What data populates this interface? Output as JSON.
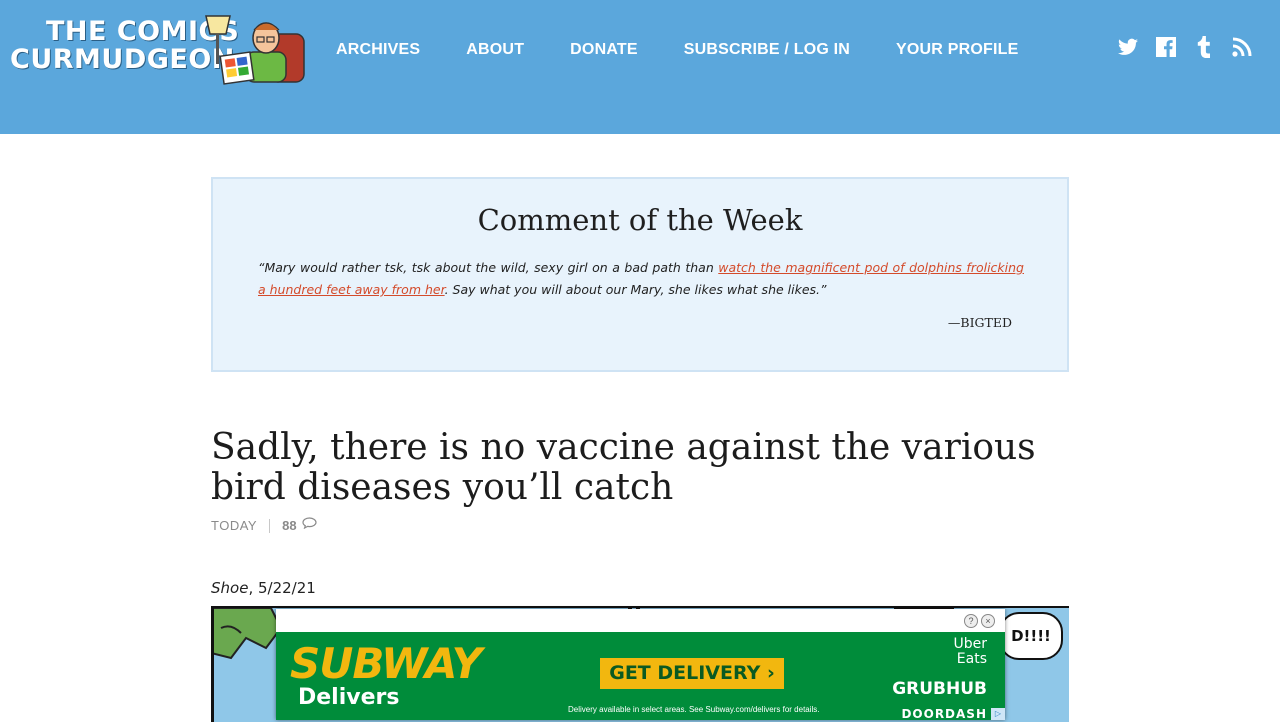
{
  "site": {
    "logo_line1": "THE COMICS",
    "logo_line2": "CURMUDGEON"
  },
  "nav": {
    "items": [
      {
        "label": "ARCHIVES"
      },
      {
        "label": "ABOUT"
      },
      {
        "label": "DONATE"
      },
      {
        "label": "SUBSCRIBE / LOG IN"
      },
      {
        "label": "YOUR PROFILE"
      }
    ]
  },
  "social": {
    "icons": [
      "twitter-icon",
      "facebook-icon",
      "tumblr-icon",
      "rss-icon"
    ]
  },
  "comment_of_week": {
    "title": "Comment of the Week",
    "quote_before": "“Mary would rather tsk, tsk about the wild, sexy girl on a bad path than ",
    "quote_link": "watch the magnificent pod of dolphins frolicking a hundred feet away from her",
    "quote_after": ". Say what you will about our Mary, she likes what she likes.”",
    "author": "—BIGTED"
  },
  "post": {
    "title": "Sadly, there is no vaccine against the various bird diseases you’ll catch",
    "date": "TODAY",
    "comment_count": "88",
    "caption_strip": "Shoe",
    "caption_date": ", 5/22/21"
  },
  "comic": {
    "bubble_text": "D!!!!"
  },
  "ad": {
    "brand_main": "SUB",
    "brand_accent": "WAY",
    "sub": "Delivers",
    "cta": "GET DELIVERY ›",
    "fine_print": "Delivery available in select areas. See Subway.com/delivers for details.",
    "partner1_line1": "Uber",
    "partner1_line2": "Eats",
    "partner2": "GRUBHUB",
    "partner3": "DOORDASH",
    "colors": {
      "green": "#008c3a",
      "yellow": "#f2b70f"
    }
  },
  "colors": {
    "header": "#5ba7dc",
    "link": "#d44b2b",
    "cotw_bg": "#e8f3fc"
  }
}
